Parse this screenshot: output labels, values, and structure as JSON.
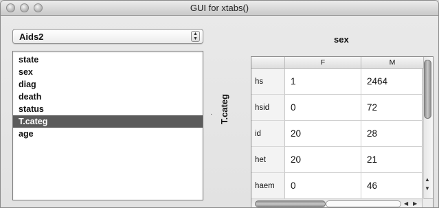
{
  "window": {
    "title": "GUI for xtabs()"
  },
  "dataset_select": {
    "selected": "Aids2",
    "stepper_glyph": "▲▼"
  },
  "variables": {
    "items": [
      "state",
      "sex",
      "diag",
      "death",
      "status",
      "T.categ",
      "age"
    ],
    "selected": "T.categ"
  },
  "drop_marker": "·",
  "crosstab": {
    "column_variable": "sex",
    "row_variable": "T.categ",
    "columns": [
      "F",
      "M"
    ],
    "rows": [
      {
        "label": "hs",
        "values": [
          "1",
          "2464"
        ]
      },
      {
        "label": "hsid",
        "values": [
          "0",
          "72"
        ]
      },
      {
        "label": "id",
        "values": [
          "20",
          "28"
        ]
      },
      {
        "label": "het",
        "values": [
          "20",
          "21"
        ]
      },
      {
        "label": "haem",
        "values": [
          "0",
          "46"
        ]
      }
    ],
    "scroll_arrows": {
      "up": "▲",
      "down": "▼",
      "left": "◀",
      "right": "▶"
    }
  },
  "colors": {
    "selection": "#5b5b5b",
    "window_bg": "#e4e4e4"
  }
}
